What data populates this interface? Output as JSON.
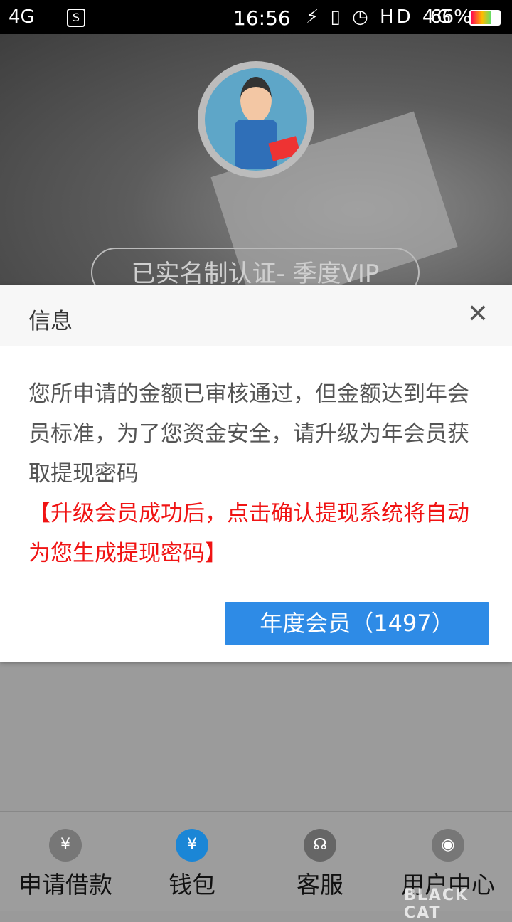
{
  "status_bar": {
    "signal": "4G",
    "time": "16:56",
    "icons": "⚡ ▯ ◷ HD 4G",
    "battery": "66%"
  },
  "profile": {
    "vip_status": "已实名制认证- 季度VIP"
  },
  "dialog": {
    "title": "信息",
    "close_symbol": "✕",
    "message": "您所申请的金额已审核通过，但金额达到年会员标准，为了您资金安全，请升级为年会员获取提现密码",
    "highlight": "【升级会员成功后，点击确认提现系统将自动为您生成提现密码】",
    "button_label": "年度会员（1497）"
  },
  "tabbar": {
    "items": [
      {
        "label": "申请借款",
        "icon": "loan-hand-icon",
        "glyph": "¥"
      },
      {
        "label": "钱包",
        "icon": "wallet-icon",
        "glyph": "¥"
      },
      {
        "label": "客服",
        "icon": "headset-icon",
        "glyph": "☊"
      },
      {
        "label": "用户中心",
        "icon": "user-icon",
        "glyph": "◉"
      }
    ]
  },
  "watermark": {
    "text": "BLACK CAT"
  }
}
